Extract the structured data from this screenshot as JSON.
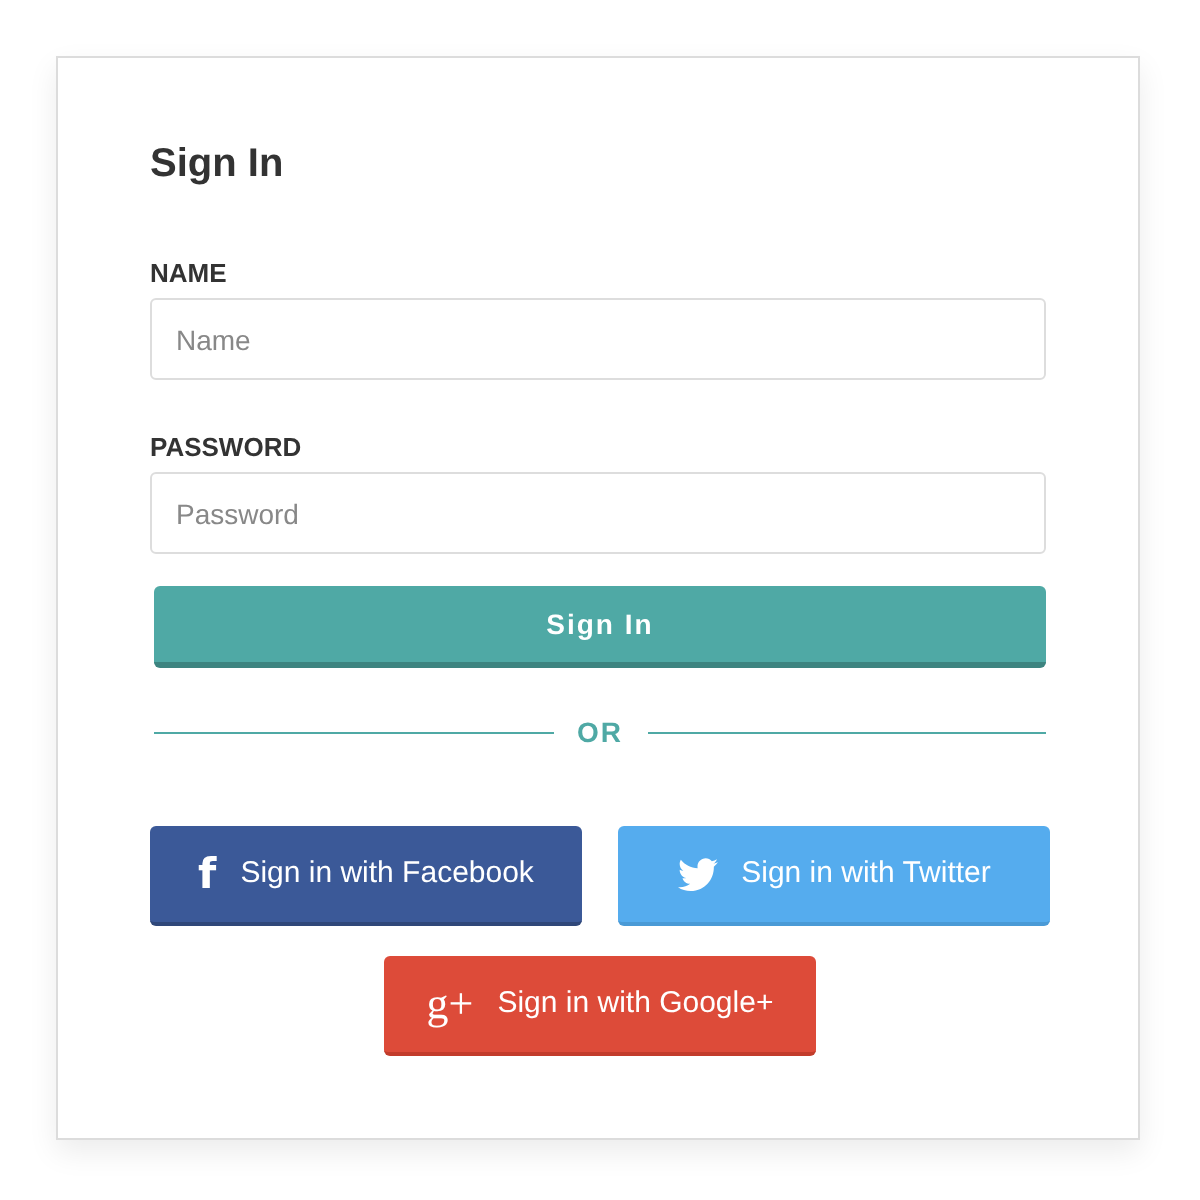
{
  "title": "Sign In",
  "fields": [
    {
      "label": "NAME",
      "placeholder": "Name"
    },
    {
      "label": "PASSWORD",
      "placeholder": "Password"
    }
  ],
  "submit": "Sign In",
  "divider": "OR",
  "social": [
    {
      "kind": "facebook",
      "glyph": "f",
      "label": "Sign in with Facebook"
    },
    {
      "kind": "twitter",
      "label": "Sign in with Twitter"
    },
    {
      "kind": "google",
      "glyph": "g+",
      "label": "Sign in with Google+"
    }
  ]
}
